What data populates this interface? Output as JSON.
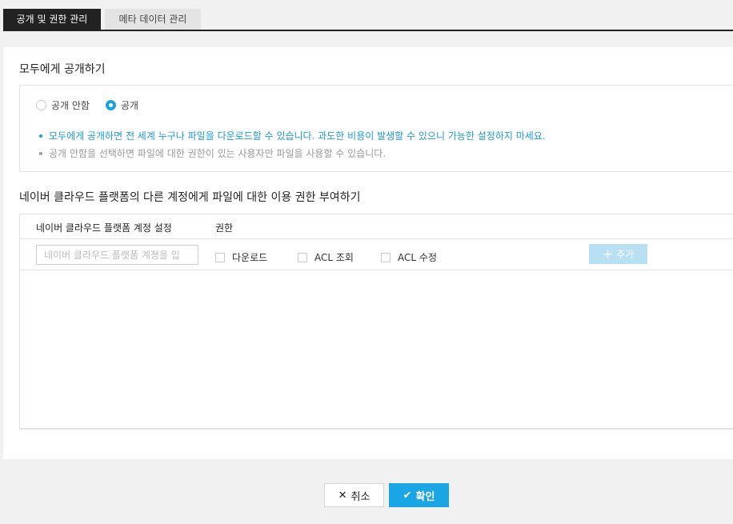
{
  "tabs": [
    {
      "label": "공개 및 권한 관리",
      "active": true
    },
    {
      "label": "메타 데이터 관리",
      "active": false
    }
  ],
  "public_section": {
    "title": "모두에게 공개하기",
    "options": [
      {
        "label": "공개 안함",
        "checked": false
      },
      {
        "label": "공개",
        "checked": true
      }
    ],
    "notes": [
      "모두에게 공개하면 전 세계 누구나 파일을 다운로드할 수 있습니다. 과도한 비용이 발생할 수 있으니 가능한 설정하지 마세요.",
      "공개 안함을 선택하면 파일에 대한 권한이 있는 사용자만 파일을 사용할 수 있습니다."
    ]
  },
  "permission_section": {
    "title": "네이버 클라우드 플랫폼의 다른 계정에게 파일에 대한 이용 권한 부여하기",
    "col_account": "네이버 클라우드 플랫폼 계정 설정",
    "col_permission": "권한",
    "account_placeholder": "네이버 클라우드 플랫폼 계정을 입",
    "checkboxes": [
      {
        "label": "다운로드",
        "checked": false
      },
      {
        "label": "ACL 조회",
        "checked": false
      },
      {
        "label": "ACL 수정",
        "checked": false
      }
    ],
    "add_label": "추가"
  },
  "footer": {
    "cancel_label": "취소",
    "ok_label": "확인"
  },
  "colors": {
    "accent": "#1aa6e4",
    "note_blue": "#1a9bd7",
    "add_disabled": "#b8e0f4",
    "tab_active_bg": "#222222"
  }
}
